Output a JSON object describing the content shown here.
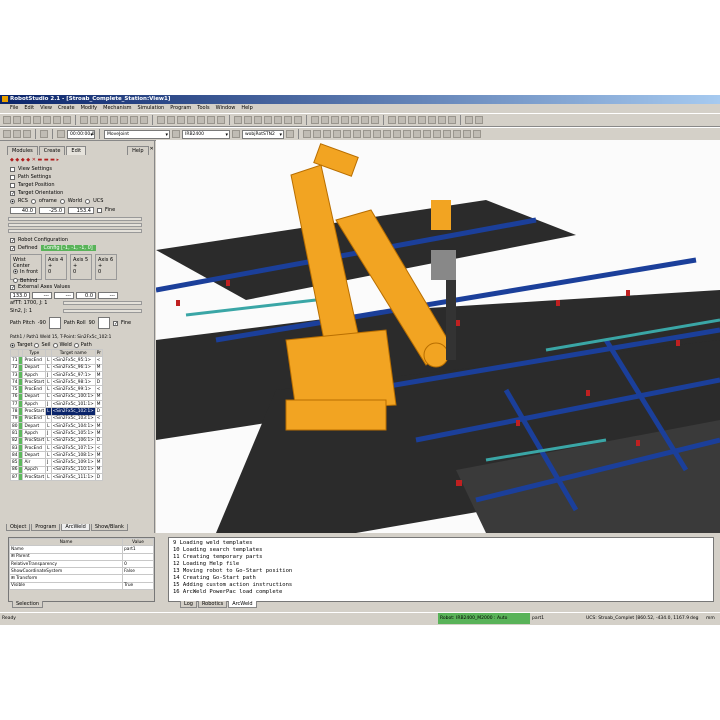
{
  "window": {
    "title": "RobotStudio 2.1 - [Stroab_Complete_Station:View1]"
  },
  "menu": [
    "File",
    "Edit",
    "View",
    "Create",
    "Modify",
    "Mechanism",
    "Simulation",
    "Program",
    "Tools",
    "Window",
    "Help"
  ],
  "toolbar": {
    "time": "00:00:00.0",
    "motion": "MoveJoint",
    "robot": "IRB2400",
    "workobject": "wobjRotSTN2"
  },
  "left_panel": {
    "tabs": [
      "Modules",
      "Create",
      "Edit"
    ],
    "active_tab": "Edit",
    "help": "Help",
    "checks": [
      {
        "label": "View Settings",
        "checked": false
      },
      {
        "label": "Path Settings",
        "checked": false
      },
      {
        "label": "Target Position",
        "checked": false
      }
    ],
    "orientation": {
      "label": "Target Orientation",
      "checked": true,
      "frames": [
        "RCS",
        "oframe",
        "World",
        "UCS"
      ],
      "selected": "RCS",
      "values": [
        "40.0",
        "-25.0",
        "153.4"
      ],
      "fine1": "Fine",
      "fine2": "Fine"
    },
    "robot_config": {
      "label": "Robot Configuration",
      "defined_label": "Defined",
      "config": "Config [-1, -1, -1, 0]",
      "wrist_center": "Wrist Center",
      "in_front": "In front",
      "behind": "Behind",
      "axes": [
        {
          "label": "Axis 4"
        },
        {
          "label": "Axis 5"
        },
        {
          "label": "Axis 6"
        }
      ],
      "plus": "+",
      "zero": "0",
      "minus": "-"
    },
    "external_axes": {
      "label": "External Axes Values",
      "values": [
        "133.0",
        "---",
        "---",
        "0.0",
        "---"
      ],
      "axis1": "afTT: 1700, J: 1",
      "axis2": "Sin2, J: 1",
      "fine": "Fine",
      "path_pitch_label": "Path Pitch",
      "path_pitch": "-90",
      "path_roll_label": "Path Roll",
      "path_roll": "90"
    },
    "path_group": {
      "label": "Path1 / Path1 Weld 15, T-Point: Sin2Fx5c_102:1",
      "modes": [
        "Target",
        "Seil",
        "Weld",
        "Path"
      ],
      "selected": "Target"
    },
    "table": {
      "headers": [
        "",
        "Type",
        "Target name",
        "Pr"
      ],
      "rows": [
        [
          "71",
          "ProcEnd",
          "L",
          "<Sin2Fx5c_95:1>",
          "<"
        ],
        [
          "72",
          "Depart",
          "L",
          "<Sin2Fx5c_96:1>",
          "M"
        ],
        [
          "73",
          "Appch",
          "J",
          "<Sin2Fx5c_97:1>",
          "M"
        ],
        [
          "74",
          "ProcStart",
          "L",
          "<Sin2Fx5c_98:1>",
          "D"
        ],
        [
          "75",
          "ProcEnd",
          "L",
          "<Sin2Fx5c_99:1>",
          "<"
        ],
        [
          "76",
          "Depart",
          "L",
          "<Sin2Fx5c_100:1>",
          "M"
        ],
        [
          "77",
          "Appch",
          "J",
          "<Sin2Fx5c_101:1>",
          "M"
        ],
        [
          "78",
          "ProcStart",
          "L",
          "<Sin2Fx5c_102:1>",
          "D"
        ],
        [
          "79",
          "ProcEnd",
          "L",
          "<Sin2Fx5c_103:1>",
          "<"
        ],
        [
          "80",
          "Depart",
          "L",
          "<Sin2Fx5c_104:1>",
          "M"
        ],
        [
          "81",
          "Appch",
          "J",
          "<Sin2Fx5c_105:1>",
          "M"
        ],
        [
          "82",
          "ProcStart",
          "L",
          "<Sin2Fx5c_106:1>",
          "D"
        ],
        [
          "83",
          "ProcEnd",
          "L",
          "<Sin2Fx5c_107:1>",
          "<"
        ],
        [
          "84",
          "Depart",
          "L",
          "<Sin2Fx5c_108:1>",
          "M"
        ],
        [
          "85",
          "Air",
          "J",
          "<Sin2Fx5c_109:1>",
          "M"
        ],
        [
          "86",
          "Appch",
          "J",
          "<Sin2Fx5c_110:1>",
          "M"
        ],
        [
          "87",
          "ProcStart",
          "L",
          "<Sin2Fx5c_111:1>",
          "D"
        ]
      ],
      "selected_row": "78"
    },
    "bottom_tabs": [
      "Object",
      "Program",
      "ArcWeld",
      "Show/Blank"
    ]
  },
  "properties": {
    "headers": [
      "Name",
      "Value"
    ],
    "rows": [
      [
        "Name",
        "part1"
      ],
      [
        "⊞ Parent",
        ""
      ],
      [
        "RelativeTransparency",
        "0"
      ],
      [
        "ShowCoordinateSystem",
        "False"
      ],
      [
        "⊞ Transform",
        ""
      ],
      [
        "Visible",
        "True"
      ]
    ],
    "tab": "Selection"
  },
  "log": {
    "lines": [
      "9 Loading weld templates",
      "10 Loading search templates",
      "11 Creating temporary parts",
      "12 Loading Help file",
      "13  Moving robot to Go-Start position",
      "14 Creating Go-Start path",
      "15 Adding custom action instructions",
      "16 ArcWeld PowerPac load complete"
    ],
    "tabs": [
      "Log",
      "Robotics",
      "ArcWeld"
    ]
  },
  "status": {
    "text": "Ready",
    "robot": "Robot: IRB2400_M2000 : Auto",
    "part": "part1",
    "ucs": "UCS: Stroab_Complet [860.52, -434.0, 1167.9",
    "unit1": "deg",
    "unit2": "mm"
  },
  "colors": {
    "robot": "#f2a422",
    "rail": "#1b3f9a",
    "frame": "#2b2b2b",
    "config_green": "#59b359",
    "selection": "#0a246a"
  }
}
